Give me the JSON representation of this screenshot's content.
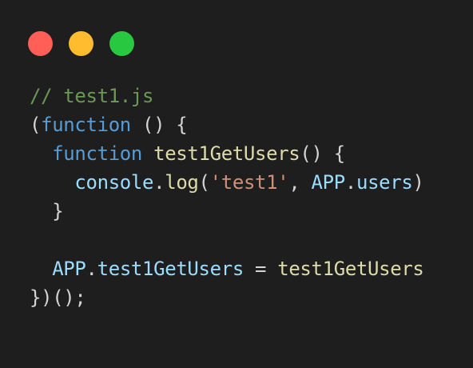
{
  "window": {
    "controls": [
      {
        "name": "close",
        "color": "#ff5f57"
      },
      {
        "name": "minimize",
        "color": "#febc2e"
      },
      {
        "name": "maximize",
        "color": "#28c840"
      }
    ]
  },
  "code": {
    "language": "javascript",
    "lines": [
      [
        {
          "t": "// test1.js",
          "k": "comment"
        }
      ],
      [
        {
          "t": "(",
          "k": "plain"
        },
        {
          "t": "function",
          "k": "keyword"
        },
        {
          "t": " () {",
          "k": "plain"
        }
      ],
      [
        {
          "t": "  ",
          "k": "plain"
        },
        {
          "t": "function",
          "k": "keyword"
        },
        {
          "t": " ",
          "k": "plain"
        },
        {
          "t": "test1GetUsers",
          "k": "function"
        },
        {
          "t": "() {",
          "k": "plain"
        }
      ],
      [
        {
          "t": "    ",
          "k": "plain"
        },
        {
          "t": "console",
          "k": "variable"
        },
        {
          "t": ".",
          "k": "plain"
        },
        {
          "t": "log",
          "k": "function"
        },
        {
          "t": "(",
          "k": "plain"
        },
        {
          "t": "'test1'",
          "k": "string"
        },
        {
          "t": ", ",
          "k": "plain"
        },
        {
          "t": "APP",
          "k": "variable"
        },
        {
          "t": ".",
          "k": "plain"
        },
        {
          "t": "users",
          "k": "variable"
        },
        {
          "t": ")",
          "k": "plain"
        }
      ],
      [
        {
          "t": "  }",
          "k": "plain"
        }
      ],
      [],
      [
        {
          "t": "  ",
          "k": "plain"
        },
        {
          "t": "APP",
          "k": "variable"
        },
        {
          "t": ".",
          "k": "plain"
        },
        {
          "t": "test1GetUsers",
          "k": "variable"
        },
        {
          "t": " = ",
          "k": "plain"
        },
        {
          "t": "test1GetUsers",
          "k": "function"
        }
      ],
      [
        {
          "t": "})();",
          "k": "plain"
        }
      ]
    ]
  },
  "colors": {
    "background": "#1e1e1e",
    "comment": "#6a9955",
    "keyword": "#569cd6",
    "function": "#dcdcaa",
    "variable": "#9cdcfe",
    "string": "#ce9178",
    "plain": "#d4d4d4"
  }
}
